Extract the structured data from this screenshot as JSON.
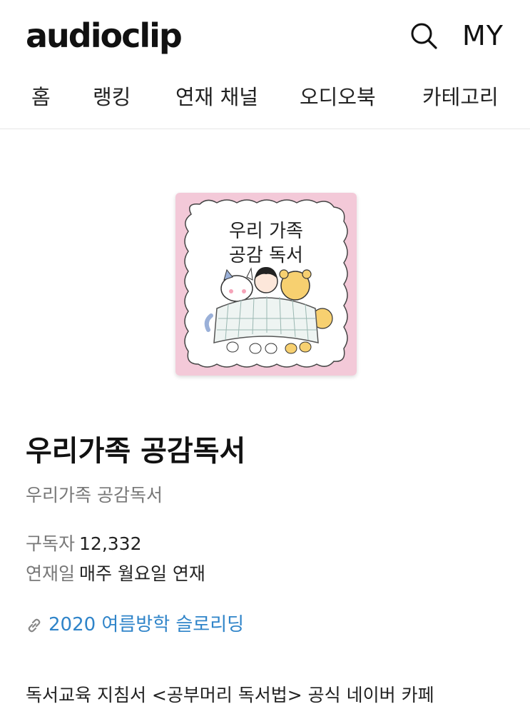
{
  "header": {
    "logo": "audioclip",
    "search_icon": "search-icon",
    "my_label": "MY"
  },
  "nav": {
    "items": [
      {
        "label": "홈"
      },
      {
        "label": "랭킹"
      },
      {
        "label": "연재 채널"
      },
      {
        "label": "오디오북"
      },
      {
        "label": "카테고리"
      }
    ]
  },
  "channel": {
    "cover_text_line1": "우리 가족",
    "cover_text_line2": "공감 독서",
    "title": "우리가족 공감독서",
    "subtitle": "우리가족 공감독서",
    "subscribers_label": "구독자",
    "subscribers_value": "12,332",
    "schedule_label": "연재일",
    "schedule_value": "매주 월요일 연재",
    "link_icon": "link-icon",
    "link_text": "2020 여름방학 슬로리딩",
    "link_color": "#2f84c9",
    "description": "독서교육 지침서 <공부머리 독서법> 공식 네이버 카페"
  }
}
